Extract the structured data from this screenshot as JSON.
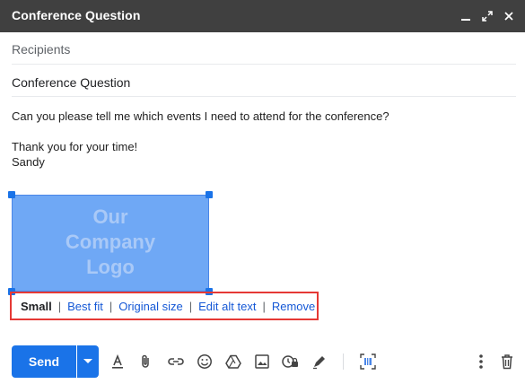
{
  "window": {
    "title": "Conference Question",
    "controls": [
      "minimize-icon",
      "expand-icon",
      "close-icon"
    ]
  },
  "recipients": {
    "placeholder": "Recipients"
  },
  "subject": {
    "value": "Conference Question"
  },
  "message": {
    "line1": "Can you please tell me which events I need to attend for the conference?",
    "line2": "Thank you for your time!",
    "line3": "Sandy"
  },
  "image": {
    "logo_line1": "Our",
    "logo_line2": "Company",
    "logo_line3": "Logo",
    "fill_color": "#6fa8f5"
  },
  "image_toolbar": {
    "small": "Small",
    "best_fit": "Best fit",
    "original_size": "Original size",
    "edit_alt_text": "Edit alt text",
    "remove": "Remove",
    "separator": "|",
    "highlight_color": "#e53935"
  },
  "footer": {
    "send_label": "Send",
    "accent": "#1a73e8",
    "tools": [
      "format-text-icon",
      "attach-icon",
      "link-icon",
      "emoji-icon",
      "drive-icon",
      "photo-icon",
      "confidential-icon",
      "signature-icon",
      "layout-icon",
      "more-options-icon",
      "trash-icon"
    ]
  }
}
